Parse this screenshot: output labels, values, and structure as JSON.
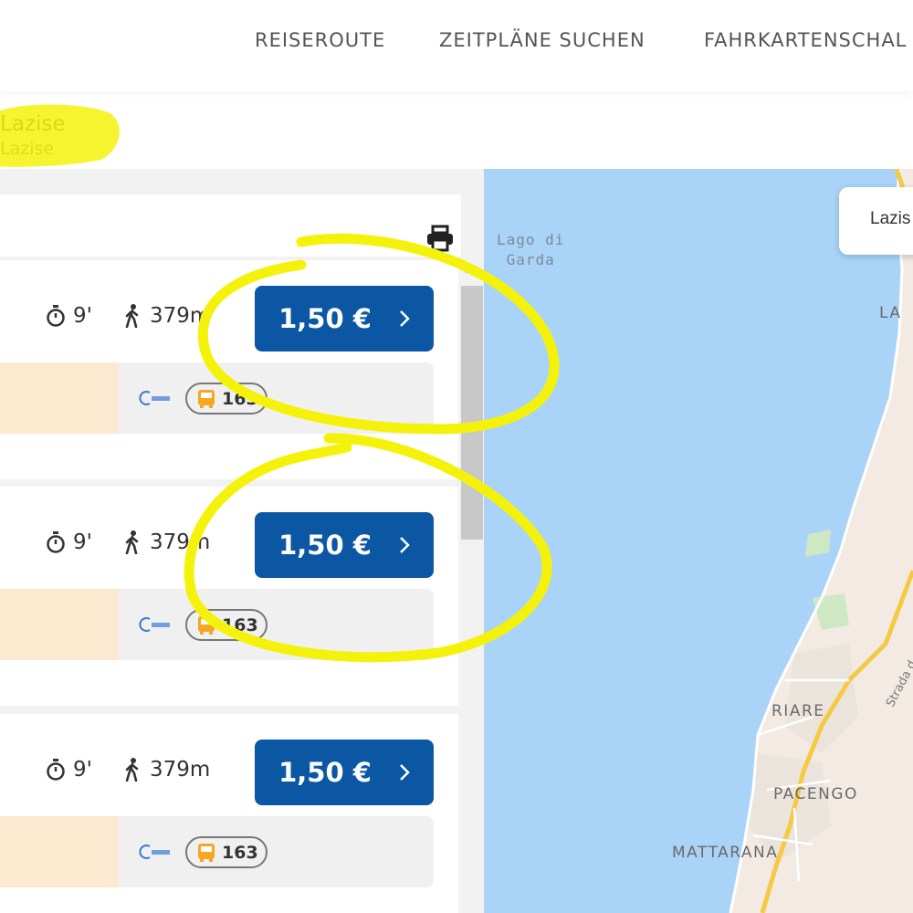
{
  "nav": {
    "items": [
      "REISEROUTE",
      "ZEITPLÄNE SUCHEN",
      "FAHRKARTENSCHAL"
    ]
  },
  "route": {
    "from": "Lazise",
    "to": "Lazise"
  },
  "toolbar": {
    "print_icon": "printer-icon"
  },
  "results": [
    {
      "duration": "9'",
      "walk": "379m",
      "price": "1,50 €",
      "line": "163"
    },
    {
      "duration": "9'",
      "walk": "379m",
      "price": "1,50 €",
      "line": "163"
    },
    {
      "duration": "9'",
      "walk": "379m",
      "price": "1,50 €",
      "line": "163"
    }
  ],
  "map": {
    "lake_label": [
      "Lago di",
      "Garda"
    ],
    "popup": "Lazis",
    "places": [
      "LA",
      "RIARE",
      "PACENGO",
      "MATTARANA"
    ],
    "road": "Strada d",
    "colors": {
      "water": "#a9d4f8",
      "land": "#f3ebe3",
      "road": "#f6c945"
    }
  },
  "colors": {
    "accent": "#0b57a4",
    "highlight": "#f4f20a",
    "route_from": "#1b5e20"
  }
}
